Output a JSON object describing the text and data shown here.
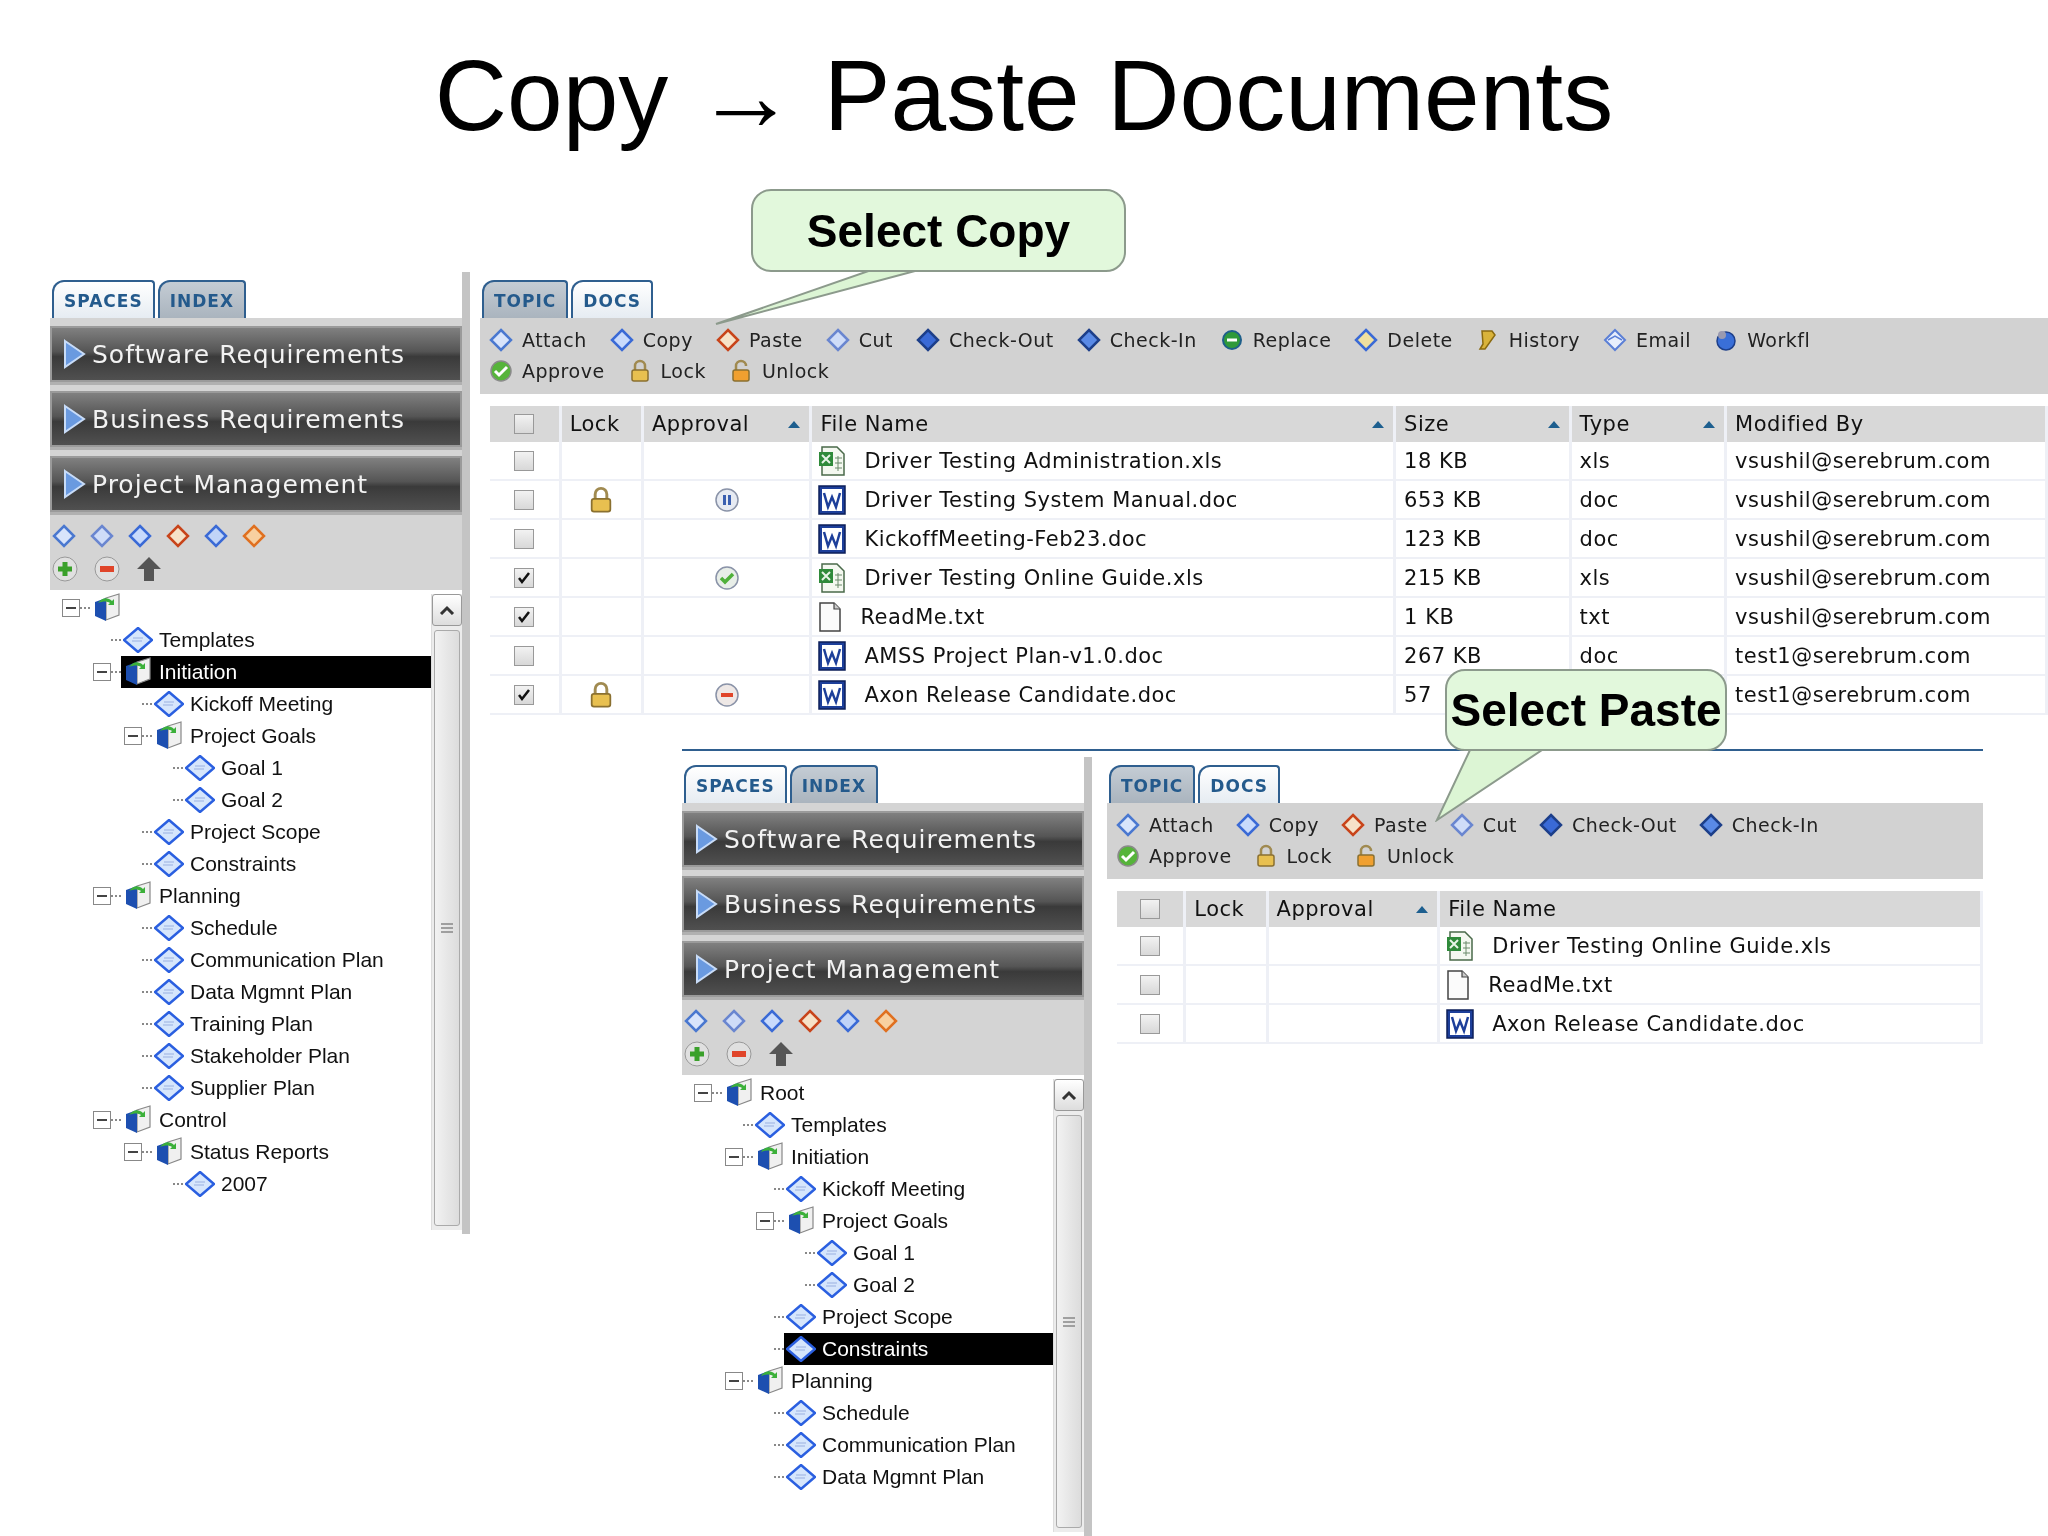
{
  "title": "Copy → Paste Documents",
  "callouts": [
    {
      "text": "Select Copy"
    },
    {
      "text": "Select Paste"
    }
  ],
  "screens": [
    {
      "left": {
        "tabs": [
          {
            "label": "SPACES",
            "selected": true
          },
          {
            "label": "INDEX",
            "selected": false
          }
        ],
        "spaces": [
          "Software Requirements",
          "Business Requirements",
          "Project Management"
        ],
        "tree": [
          {
            "kind": "folder",
            "expanded": true,
            "selected": false,
            "children": [
              {
                "kind": "page",
                "label": "Templates",
                "selected": false
              },
              {
                "kind": "folder",
                "label": "Initiation",
                "expanded": true,
                "selected": true,
                "children": [
                  {
                    "kind": "page",
                    "label": "Kickoff Meeting",
                    "selected": false
                  },
                  {
                    "kind": "folder",
                    "label": "Project Goals",
                    "expanded": true,
                    "selected": false,
                    "children": [
                      {
                        "kind": "page",
                        "label": "Goal 1",
                        "selected": false
                      },
                      {
                        "kind": "page",
                        "label": "Goal 2",
                        "selected": false
                      }
                    ]
                  },
                  {
                    "kind": "page",
                    "label": "Project Scope",
                    "selected": false
                  },
                  {
                    "kind": "page",
                    "label": "Constraints",
                    "selected": false
                  }
                ]
              },
              {
                "kind": "folder",
                "label": "Planning",
                "expanded": true,
                "selected": false,
                "children": [
                  {
                    "kind": "page",
                    "label": "Schedule",
                    "selected": false
                  },
                  {
                    "kind": "page",
                    "label": "Communication Plan",
                    "selected": false
                  },
                  {
                    "kind": "page",
                    "label": "Data Mgmnt Plan",
                    "selected": false
                  },
                  {
                    "kind": "page",
                    "label": "Training Plan",
                    "selected": false
                  },
                  {
                    "kind": "page",
                    "label": "Stakeholder Plan",
                    "selected": false
                  },
                  {
                    "kind": "page",
                    "label": "Supplier Plan",
                    "selected": false
                  }
                ]
              },
              {
                "kind": "folder",
                "label": "Control",
                "expanded": true,
                "selected": false,
                "children": [
                  {
                    "kind": "folder",
                    "label": "Status Reports",
                    "expanded": true,
                    "selected": false,
                    "children": [
                      {
                        "kind": "page",
                        "label": "2007",
                        "selected": false
                      }
                    ]
                  }
                ]
              }
            ]
          }
        ]
      },
      "right": {
        "tabs": [
          {
            "label": "TOPIC",
            "selected": false
          },
          {
            "label": "DOCS",
            "selected": true
          }
        ],
        "toolbar_rows": [
          [
            "Attach",
            "Copy",
            "Paste",
            "Cut",
            "Check-Out",
            "Check-In",
            "Replace",
            "Delete",
            "History",
            "Email",
            "Workfl"
          ],
          [
            "Approve",
            "Lock",
            "Unlock"
          ]
        ],
        "header_checked": false,
        "columns": [
          {
            "label": "Lock",
            "sorted": false
          },
          {
            "label": "Approval",
            "sorted": true
          },
          {
            "label": "File Name",
            "sorted": true
          },
          {
            "label": "Size",
            "sorted": true
          },
          {
            "label": "Type",
            "sorted": true
          },
          {
            "label": "Modified By",
            "sorted": false
          }
        ],
        "rows": [
          {
            "checked": false,
            "locked": false,
            "file": {
              "kind": "spreadsheet"
            },
            "cells": {
              "file_name": "Driver Testing Administration.xls",
              "size": "18 KB",
              "type": "xls",
              "modified_by": "vsushil@serebrum.com"
            }
          },
          {
            "checked": false,
            "locked": true,
            "approval": {
              "kind": "pending"
            },
            "file": {
              "kind": "document"
            },
            "cells": {
              "file_name": "Driver Testing System Manual.doc",
              "size": "653 KB",
              "type": "doc",
              "modified_by": "vsushil@serebrum.com"
            }
          },
          {
            "checked": false,
            "locked": false,
            "file": {
              "kind": "document"
            },
            "cells": {
              "file_name": "KickoffMeeting-Feb23.doc",
              "size": "123 KB",
              "type": "doc",
              "modified_by": "vsushil@serebrum.com"
            }
          },
          {
            "checked": true,
            "locked": false,
            "approval": {
              "kind": "approved"
            },
            "file": {
              "kind": "spreadsheet"
            },
            "cells": {
              "file_name": "Driver Testing Online Guide.xls",
              "size": "215 KB",
              "type": "xls",
              "modified_by": "vsushil@serebrum.com"
            }
          },
          {
            "checked": true,
            "locked": false,
            "file": {
              "kind": "text"
            },
            "cells": {
              "file_name": "ReadMe.txt",
              "size": "1 KB",
              "type": "txt",
              "modified_by": "vsushil@serebrum.com"
            }
          },
          {
            "checked": false,
            "locked": false,
            "file": {
              "kind": "document"
            },
            "cells": {
              "file_name": "AMSS Project Plan-v1.0.doc",
              "size": "267 KB",
              "type": "doc",
              "modified_by": "test1@serebrum.com"
            }
          },
          {
            "checked": true,
            "locked": true,
            "approval": {
              "kind": "rejected"
            },
            "file": {
              "kind": "document"
            },
            "cells": {
              "file_name": "Axon Release Candidate.doc",
              "size": "57",
              "modified_by": "test1@serebrum.com"
            }
          }
        ]
      }
    },
    {
      "left": {
        "tabs": [
          {
            "label": "SPACES",
            "selected": true
          },
          {
            "label": "INDEX",
            "selected": false
          }
        ],
        "spaces": [
          "Software Requirements",
          "Business Requirements",
          "Project Management"
        ],
        "tree": [
          {
            "kind": "folder",
            "label": "Root",
            "expanded": true,
            "selected": false,
            "children": [
              {
                "kind": "page",
                "label": "Templates",
                "selected": false
              },
              {
                "kind": "folder",
                "label": "Initiation",
                "expanded": true,
                "selected": false,
                "children": [
                  {
                    "kind": "page",
                    "label": "Kickoff Meeting",
                    "selected": false
                  },
                  {
                    "kind": "folder",
                    "label": "Project Goals",
                    "expanded": true,
                    "selected": false,
                    "children": [
                      {
                        "kind": "page",
                        "label": "Goal 1",
                        "selected": false
                      },
                      {
                        "kind": "page",
                        "label": "Goal 2",
                        "selected": false
                      }
                    ]
                  },
                  {
                    "kind": "page",
                    "label": "Project Scope",
                    "selected": false
                  },
                  {
                    "kind": "page",
                    "label": "Constraints",
                    "selected": true
                  }
                ]
              },
              {
                "kind": "folder",
                "label": "Planning",
                "expanded": true,
                "selected": false,
                "children": [
                  {
                    "kind": "page",
                    "label": "Schedule",
                    "selected": false
                  },
                  {
                    "kind": "page",
                    "label": "Communication Plan",
                    "selected": false
                  },
                  {
                    "kind": "page",
                    "label": "Data Mgmnt Plan",
                    "selected": false
                  }
                ]
              }
            ]
          }
        ]
      },
      "right": {
        "tabs": [
          {
            "label": "TOPIC",
            "selected": false
          },
          {
            "label": "DOCS",
            "selected": true
          }
        ],
        "toolbar_rows": [
          [
            "Attach",
            "Copy",
            "Paste",
            "Cut",
            "Check-Out",
            "Check-In"
          ],
          [
            "Approve",
            "Lock",
            "Unlock"
          ]
        ],
        "header_checked": false,
        "columns": [
          {
            "label": "Lock",
            "sorted": false
          },
          {
            "label": "Approval",
            "sorted": true
          },
          {
            "label": "File Name",
            "sorted": false
          }
        ],
        "rows": [
          {
            "checked": false,
            "locked": false,
            "file": {
              "kind": "spreadsheet"
            },
            "cells": {
              "file_name": "Driver Testing Online Guide.xls"
            }
          },
          {
            "checked": false,
            "locked": false,
            "file": {
              "kind": "text"
            },
            "cells": {
              "file_name": "ReadMe.txt"
            }
          },
          {
            "checked": false,
            "locked": false,
            "file": {
              "kind": "document"
            },
            "cells": {
              "file_name": "Axon Release Candidate.doc"
            }
          }
        ]
      }
    }
  ]
}
